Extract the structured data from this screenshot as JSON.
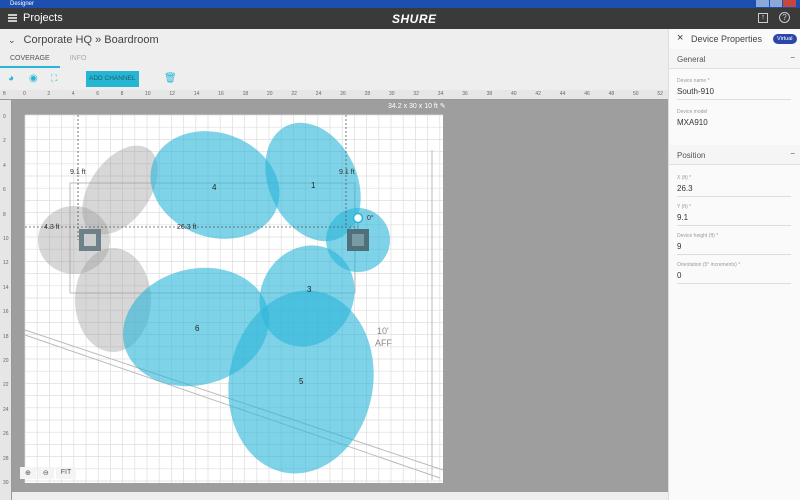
{
  "window": {
    "title": "Designer"
  },
  "appbar": {
    "title": "Projects",
    "logo": "SHURE",
    "icons": [
      "present-icon",
      "help-icon"
    ]
  },
  "breadcrumb": "Corporate HQ » Boardroom",
  "tabs": [
    {
      "label": "COVERAGE",
      "active": true
    },
    {
      "label": "INFO",
      "active": false
    }
  ],
  "toolbar": {
    "add_channel": "ADD CHANNEL",
    "icons": [
      "coverage-icon",
      "hide-icon",
      "fullscreen-icon",
      "delete-icon"
    ]
  },
  "ruler": {
    "unit": "ft",
    "top": [
      "0",
      "2",
      "4",
      "6",
      "8",
      "10",
      "12",
      "14",
      "16",
      "18",
      "20",
      "22",
      "24",
      "26",
      "28",
      "30",
      "32",
      "34",
      "36",
      "38",
      "40",
      "42",
      "44",
      "46",
      "48",
      "50",
      "52"
    ],
    "left": [
      "0",
      "2",
      "4",
      "6",
      "8",
      "10",
      "12",
      "14",
      "16",
      "18",
      "20",
      "22",
      "24",
      "26",
      "28",
      "30"
    ]
  },
  "room": {
    "dimensions": "34.2 x 30 x 10 ft",
    "ceiling_note_1": "10'",
    "ceiling_note_2": "AFF"
  },
  "annotations": {
    "d1": "9.1 ft",
    "d2": "9.1 ft",
    "d3": "4.3 ft",
    "d4": "26.3 ft",
    "angle": "0°"
  },
  "lobes": [
    "4",
    "1",
    "3",
    "6",
    "5"
  ],
  "accent": "#2ab5d8",
  "zoom": {
    "in": "+",
    "out": "−",
    "fit": "FIT"
  },
  "panel": {
    "title": "Device Properties",
    "badge": "Virtual",
    "general": {
      "label": "General",
      "device_name_label": "Device name *",
      "device_name": "South-910",
      "device_model_label": "Device model",
      "device_model": "MXA910"
    },
    "position": {
      "label": "Position",
      "x_label": "X (ft) *",
      "x": "26.3",
      "y_label": "Y (ft) *",
      "y": "9.1",
      "height_label": "Device height (ft) *",
      "height": "9",
      "orientation_label": "Orientation (5° increments) *",
      "orientation": "0"
    }
  }
}
